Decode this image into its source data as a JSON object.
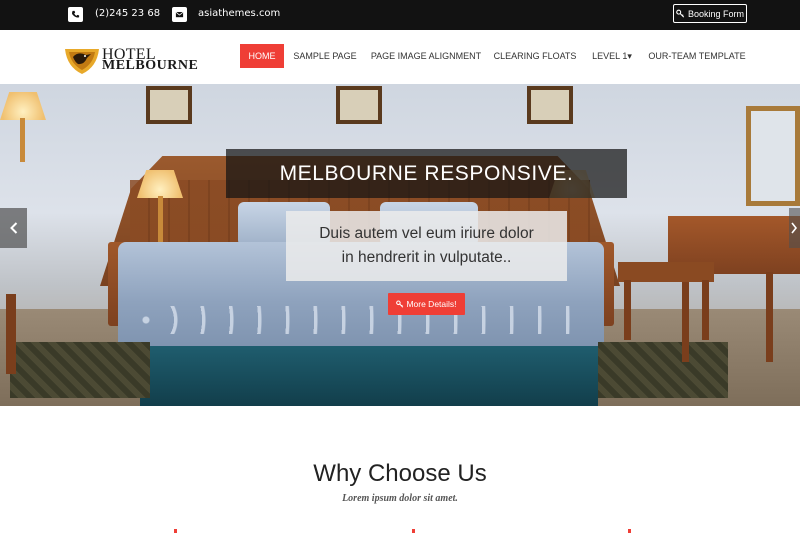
{
  "topbar": {
    "phone_icon": "phone-icon",
    "phone": "(2)245 23 68",
    "email_icon": "mail-icon",
    "email": "asiathemes.com",
    "booking_icon": "key-icon",
    "booking_label": "Booking Form"
  },
  "header": {
    "logo_line1": "HOTEL",
    "logo_line2": "MELBOURNE",
    "logo_emblem_icon": "eagle-emblem-icon",
    "nav": [
      {
        "label": "HOME",
        "active": true
      },
      {
        "label": "SAMPLE PAGE"
      },
      {
        "label": "PAGE IMAGE ALIGNMENT"
      },
      {
        "label": "CLEARING FLOATS"
      },
      {
        "label": "LEVEL 1▾"
      },
      {
        "label": "OUR-TEAM TEMPLATE"
      }
    ]
  },
  "hero": {
    "title": "MELBOURNE RESPONSIVE.",
    "subtitle_line1": "Duis autem vel eum iriure dolor",
    "subtitle_line2": "in hendrerit in vulputate..",
    "button_icon": "key-icon",
    "button_label": "More Details!",
    "prev_icon": "chevron-left-icon",
    "next_icon": "chevron-right-icon"
  },
  "section": {
    "title": "Why Choose Us",
    "subtitle": "Lorem ipsum dolor sit amet."
  },
  "colors": {
    "accent": "#ef3e36",
    "topbar_bg": "#121212",
    "text_dark": "#222222"
  }
}
